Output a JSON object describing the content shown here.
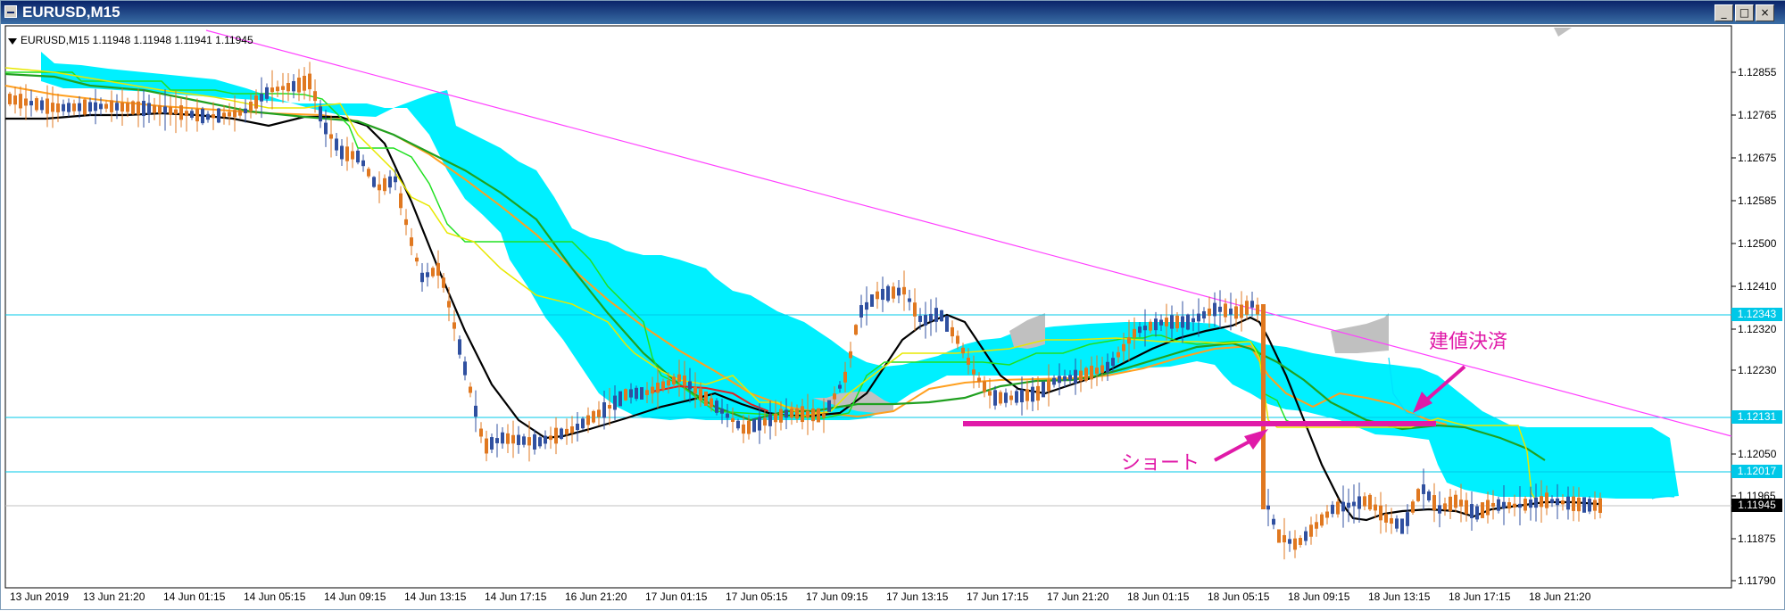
{
  "window": {
    "title": "EURUSD,M15",
    "buttons": [
      "_",
      "□",
      "×"
    ]
  },
  "chart": {
    "symbol_label": "EURUSD,M15  1.11948 1.11948 1.11941 1.11945",
    "y_ticks": [
      "1.12855",
      "1.12765",
      "1.12675",
      "1.12585",
      "1.12500",
      "1.12410",
      "1.12320",
      "1.12230",
      "1.12050",
      "1.11965",
      "1.11875",
      "1.11790"
    ],
    "x_ticks": [
      "13 Jun 2019",
      "13 Jun 21:20",
      "14 Jun 01:15",
      "14 Jun 05:15",
      "14 Jun 09:15",
      "14 Jun 13:15",
      "14 Jun 17:15",
      "16 Jun 21:20",
      "17 Jun 01:15",
      "17 Jun 05:15",
      "17 Jun 09:15",
      "17 Jun 13:15",
      "17 Jun 17:15",
      "17 Jun 21:20",
      "18 Jun 01:15",
      "18 Jun 05:15",
      "18 Jun 09:15",
      "18 Jun 13:15",
      "18 Jun 17:15",
      "18 Jun 21:20"
    ],
    "hline_labels": {
      "level_1": "1.12343",
      "level_2": "1.12131",
      "level_3": "1.12017",
      "current": "1.11945"
    },
    "annotations": {
      "short": "ショート",
      "close_breakeven": "建値決済"
    },
    "colors": {
      "cloud": "#00f0ff",
      "cloud_bear": "#c0c0c0",
      "hline": "#00c8e8",
      "trendline": "#ff40ff",
      "candle_up": "#3050a0",
      "candle_down": "#e07820",
      "ma_black": "#000000",
      "ma_orange": "#ffa020",
      "ma_green": "#20b020",
      "tenkan_lime": "#20e020",
      "chikou_yellow": "#e8e800",
      "ma_red": "#e02020",
      "annotation": "#e01aa8"
    }
  }
}
